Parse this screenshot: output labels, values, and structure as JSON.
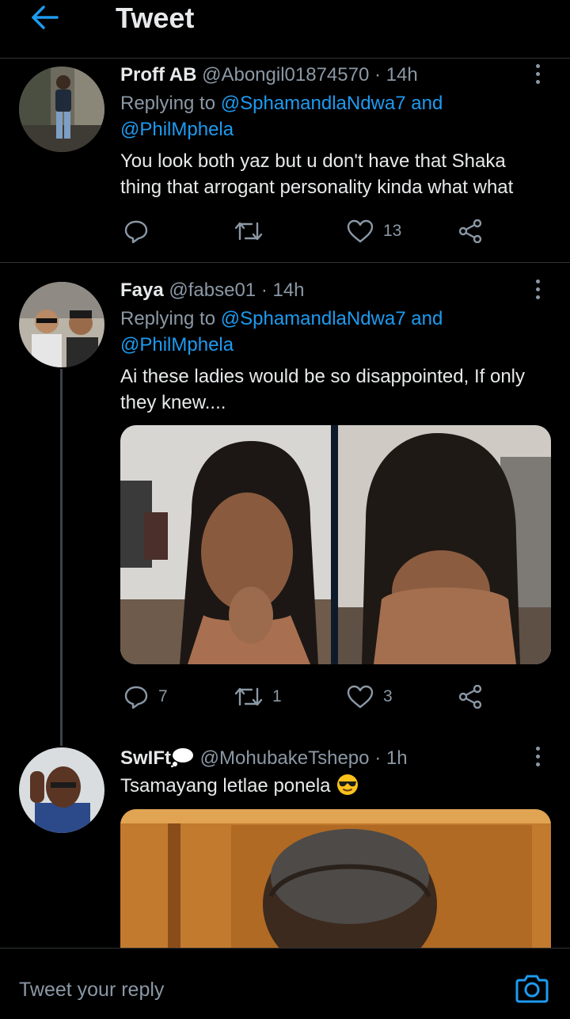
{
  "header": {
    "title": "Tweet",
    "back_icon": "arrow-left-icon"
  },
  "colors": {
    "link": "#1d9bf0",
    "muted": "#8b98a5",
    "background": "#000000"
  },
  "tweets": [
    {
      "name": "Proff AB",
      "handle": "@Abongil01874570",
      "time": "· 14h",
      "replying_prefix": "Replying to",
      "replying_user1": "@SphamandlaNdwa7",
      "replying_and": "and",
      "replying_user2": "@PhilMphela",
      "text_line1": "You look both yaz but u don't have that Shaka",
      "text_line2": "thing that arrogant personality kinda what what",
      "reply_count": "",
      "retweet_count": "",
      "like_count": "13"
    },
    {
      "name": "Faya",
      "handle": "@fabse01",
      "time": "· 14h",
      "replying_prefix": "Replying to",
      "replying_user1": "@SphamandlaNdwa7",
      "replying_and": "and",
      "replying_user2": "@PhilMphela",
      "text_line1": "Ai these ladies would be so disappointed, If only",
      "text_line2": "they knew....",
      "reply_count": "7",
      "retweet_count": "1",
      "like_count": "3"
    },
    {
      "name": "SwIFt",
      "handle": "@MohubakeTshepo",
      "time": "· 1h",
      "text_line1": "Tsamayang letlae ponela"
    }
  ],
  "composer": {
    "placeholder": "Tweet your reply",
    "camera_icon": "camera-icon"
  }
}
